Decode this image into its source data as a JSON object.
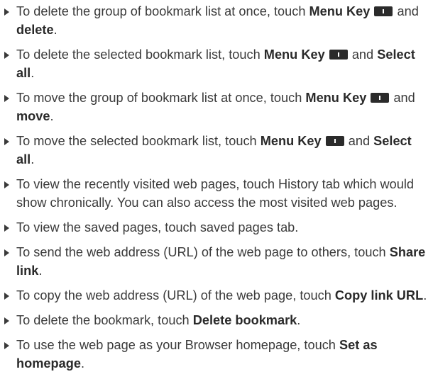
{
  "items": [
    {
      "t1": "To delete the group of bookmark list at once, touch ",
      "b1": "Menu Key",
      "t2": " and ",
      "b2": "delete",
      "t3": "."
    },
    {
      "t1": "To delete the selected bookmark list, touch ",
      "b1": "Menu Key",
      "t2": " and ",
      "b2": "Select all",
      "t3": "."
    },
    {
      "t1": "To move the group of bookmark list at once, touch ",
      "b1": "Menu Key",
      "t2": " and ",
      "b2": "move",
      "t3": "."
    },
    {
      "t1": "To move the selected bookmark list, touch ",
      "b1": "Menu Key",
      "t2": " and ",
      "b2": "Select all",
      "t3": "."
    },
    {
      "t1": "To view the recently visited web pages, touch History tab which would show chronically. You can also access the most visited web pages."
    },
    {
      "t1": "To view the saved pages, touch saved pages tab."
    },
    {
      "t1": "To send the web address (URL) of the web page to others, touch ",
      "b1": "Share link",
      "t2": "."
    },
    {
      "t1": "To copy the web address (URL) of the web page, touch ",
      "b1": "Copy link URL",
      "t2": "."
    },
    {
      "t1": "To delete the bookmark, touch ",
      "b1": "Delete bookmark",
      "t2": "."
    },
    {
      "t1": "To use the web page as your Browser homepage, touch ",
      "b1": "Set as homepage",
      "t2": "."
    }
  ],
  "icons": {
    "bullet": "triangle-right-icon",
    "menu_key": "menu-key-icon"
  },
  "colors": {
    "text": "#3a3a3a",
    "key": "#2b2b2b"
  }
}
